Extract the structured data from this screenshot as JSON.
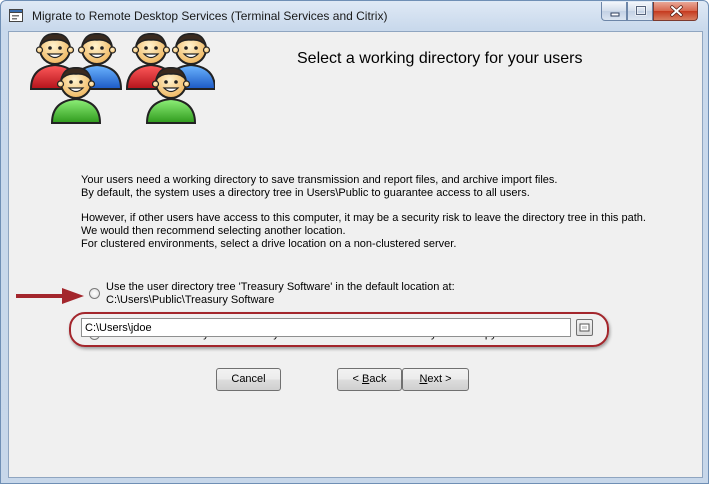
{
  "window": {
    "title": "Migrate to Remote Desktop Services (Terminal Services and Citrix)"
  },
  "main": {
    "heading": "Select a working directory for your users",
    "paragraphs": [
      "Your users need a working directory to save transmission and report files, and archive import files.",
      "By default, the system uses a directory tree in Users\\Public to guarantee access to all users.",
      "However, if other users have access to this computer, it may be a security risk to leave the directory tree in this path.",
      "We would then recommend selecting another location.",
      "For clustered environments, select a drive location on a non-clustered server."
    ],
    "option_default": {
      "line1": "Use the user directory tree 'Treasury Software' in the default location at:",
      "line2": "C:\\Users\\Public\\Treasury Software",
      "selected": false
    },
    "option_custom": {
      "label": "Move to the directory below. The system will create a subfolder for you and copy the files.",
      "selected": true
    },
    "directory_input": {
      "value": "C:\\Users\\jdoe"
    }
  },
  "buttons": {
    "cancel": "Cancel",
    "back_prefix": "< ",
    "back_mnemonic": "B",
    "back_rest": "ack",
    "next_mnemonic": "N",
    "next_rest": "ext >"
  },
  "icons": {
    "app": "app-window-icon",
    "users_graphic": "user-group-icon",
    "browse": "browse-folder-icon",
    "arrow": "red-arrow-icon"
  },
  "colors": {
    "annotation": "#a3262c",
    "client_bg": "#f0f0f0"
  }
}
